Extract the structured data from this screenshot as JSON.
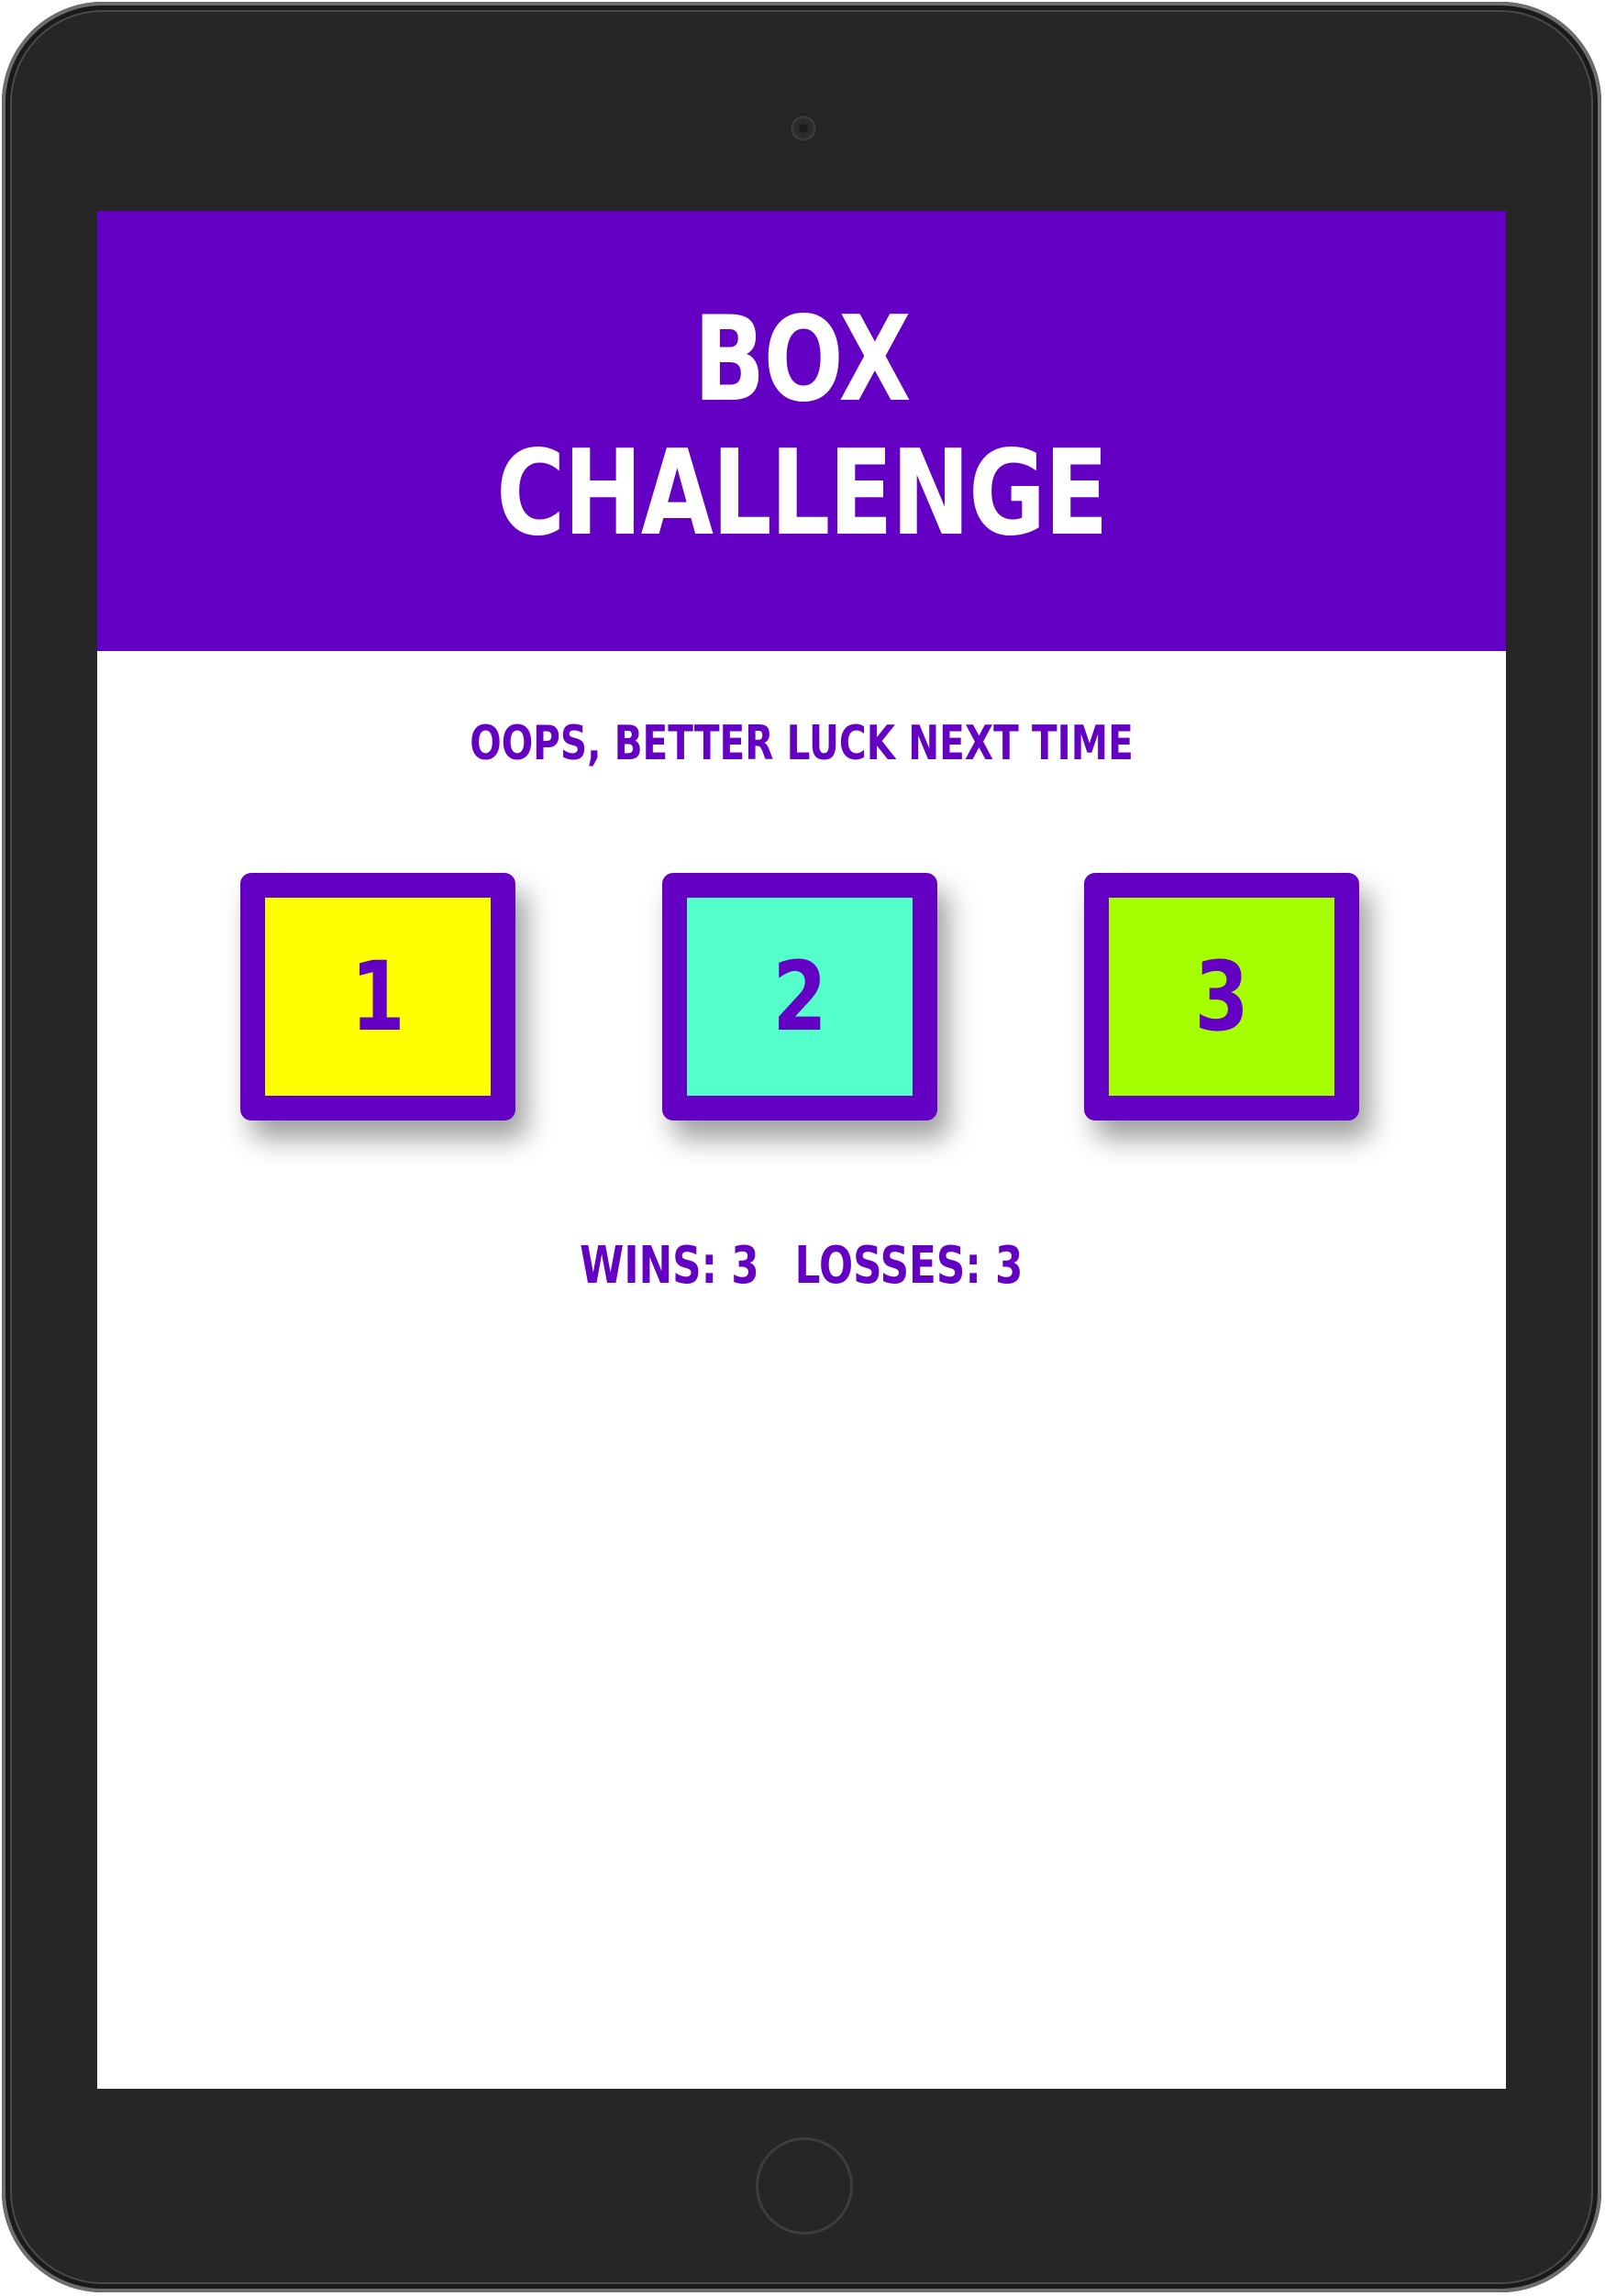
{
  "game": {
    "title_line1": "BOX",
    "title_line2": "CHALLENGE",
    "message": "OOPS, BETTER LUCK NEXT TIME",
    "boxes": [
      {
        "label": "1",
        "color": "#ffff00"
      },
      {
        "label": "2",
        "color": "#55ffcc"
      },
      {
        "label": "3",
        "color": "#a6ff00"
      }
    ],
    "wins_label": "WINS: 3",
    "losses_label": "LOSSES: 3"
  },
  "colors": {
    "brand": "#6400c4",
    "device": "#262626"
  }
}
